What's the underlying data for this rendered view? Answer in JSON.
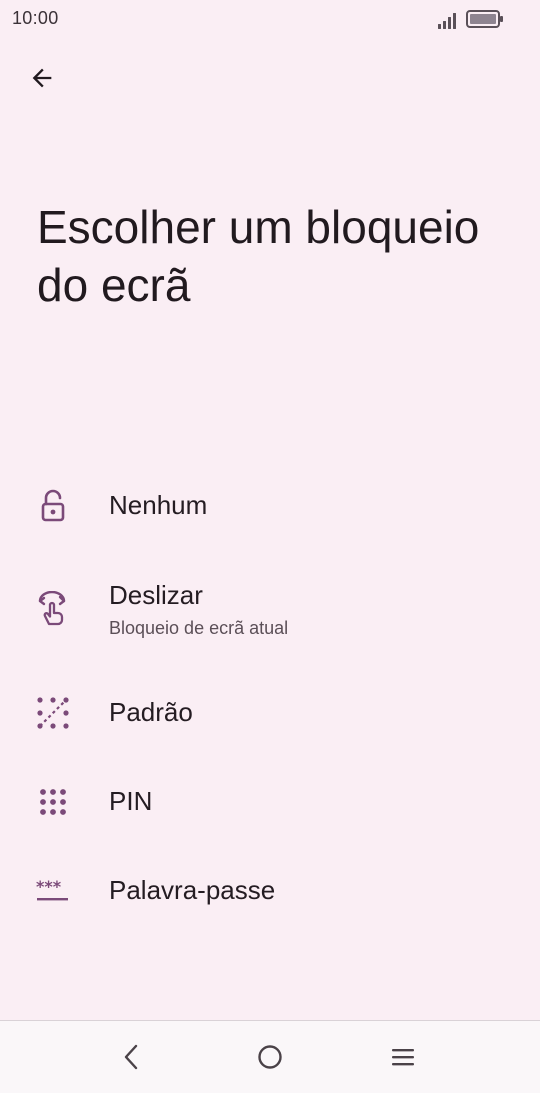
{
  "status_bar": {
    "time": "10:00",
    "signal_icon": "signal-bars-icon",
    "battery_icon": "battery-icon"
  },
  "header": {
    "back_icon": "arrow-back-icon"
  },
  "page": {
    "title": "Escolher um bloqueio do ecrã"
  },
  "options": [
    {
      "label": "Nenhum",
      "sublabel": "",
      "icon": "unlocked-padlock-icon"
    },
    {
      "label": "Deslizar",
      "sublabel": "Bloqueio de ecrã atual",
      "icon": "swipe-gesture-icon"
    },
    {
      "label": "Padrão",
      "sublabel": "",
      "icon": "pattern-icon"
    },
    {
      "label": "PIN",
      "sublabel": "",
      "icon": "pin-dots-icon"
    },
    {
      "label": "Palavra-passe",
      "sublabel": "",
      "icon": "password-asterisks-icon"
    }
  ],
  "navigation_bar": {
    "back_icon": "nav-back-icon",
    "home_icon": "nav-home-icon",
    "recents_icon": "nav-recents-icon"
  },
  "colors": {
    "background": "#FAEEF4",
    "icon_accent": "#7B4A79",
    "text_primary": "#211A1F",
    "text_secondary": "#5B4F57"
  }
}
